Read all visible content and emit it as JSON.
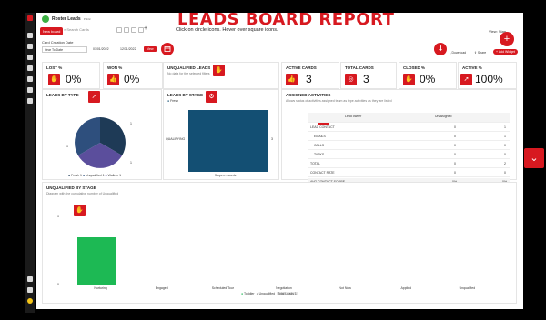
{
  "app": {
    "name": "Roster Leads",
    "visibility": "Public"
  },
  "header": {
    "title": "LEADS BOARD REPORT",
    "subtitle": "Click on circle icons. Hover over square icons.",
    "new_board": "New board",
    "search_placeholder": "Search Cards",
    "view_label": "View: Stan..."
  },
  "filters": {
    "date_label": "Card Creation Date",
    "date_range": "Year To Date",
    "start_date": "01/01/2022",
    "end_date": "12/31/2022",
    "view_button": "View"
  },
  "actions": {
    "download": "Download",
    "share": "Share",
    "add_widget": "+ Add Widget"
  },
  "cards": {
    "lost": {
      "title": "LOST %",
      "value": "0%"
    },
    "won": {
      "title": "WON %",
      "value": "0%"
    },
    "unqualified": {
      "title": "UNQUALIFIED LEADS",
      "subtitle": "No data for the selected filters"
    },
    "active": {
      "title": "ACTIVE CARDS",
      "value": "3"
    },
    "total": {
      "title": "TOTAL CARDS",
      "value": "3"
    },
    "closed": {
      "title": "CLOSED %",
      "value": "0%"
    },
    "active_pct": {
      "title": "ACTIVE %",
      "value": "100%"
    }
  },
  "type_chart": {
    "title": "LEADS BY TYPE",
    "legend": [
      "Fresh 1",
      "Unqualified 1",
      "Walk-in 1"
    ],
    "labels": [
      "1",
      "1",
      "1"
    ]
  },
  "stage_chart": {
    "title": "LEADS BY STAGE",
    "legend": "Fresh",
    "category": "QUALIFYING",
    "xlabel": "3 open records",
    "value_label": "3"
  },
  "activities": {
    "title": "ASSIGNED ACTIVITIES",
    "subtitle": "Allows status of activities assigned team as type activities as they are listed",
    "headers": [
      "",
      "Lead owner",
      "Unassigned"
    ],
    "rows": [
      [
        "LEAD CONTACT",
        "0",
        "1"
      ],
      [
        "EMAILS",
        "0",
        "1"
      ],
      [
        "CALLS",
        "0",
        "0"
      ],
      [
        "TASKS",
        "0",
        "0"
      ],
      [
        "TOTAL",
        "0",
        "2"
      ],
      [
        "CONTACT RATE",
        "0",
        "0"
      ],
      [
        "AVG CONTACT SCORE",
        "0%",
        "0%"
      ]
    ]
  },
  "unqualified_chart": {
    "title": "UNQUALIFIED BY STAGE",
    "subtitle": "Diagram with the cumulative number of Unqualified",
    "categories": [
      "Nurturing",
      "Engaged",
      "Scheduled Tour",
      "Negotiation",
      "Not Now",
      "Applied",
      "Unqualified"
    ],
    "values": [
      1,
      0,
      0,
      0,
      0,
      0,
      0
    ],
    "legend": [
      "Toddler",
      "Unqualified",
      "Total Leads 1"
    ],
    "yticks": [
      "1",
      "0"
    ]
  },
  "colors": {
    "accent": "#d71920",
    "pie1": "#1e3a56",
    "pie2": "#5b4e9c",
    "pie3": "#2e4f7d",
    "bar_blue": "#134f73",
    "bar_green": "#1db954"
  }
}
